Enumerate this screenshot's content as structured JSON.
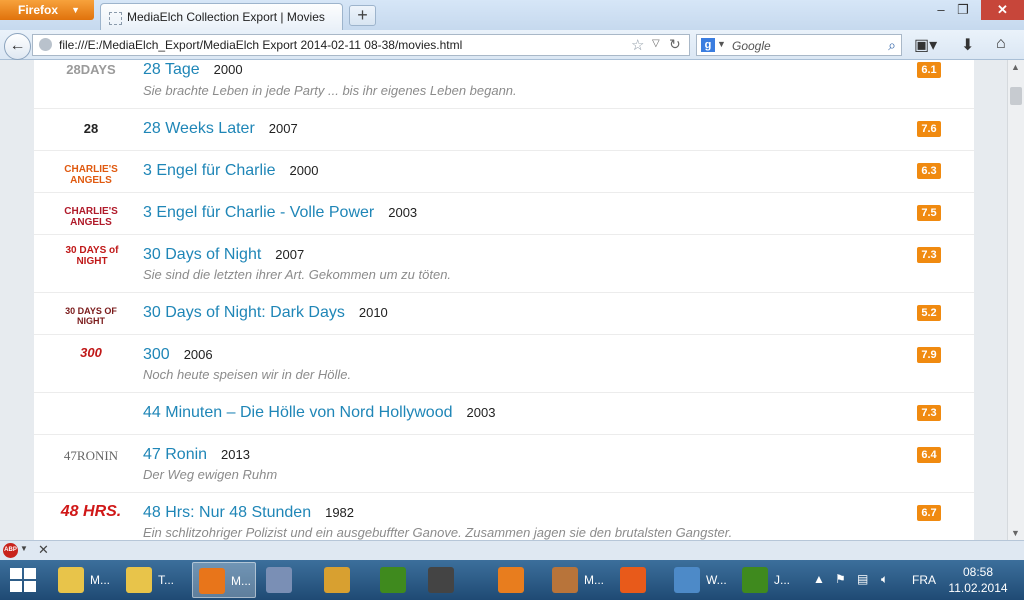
{
  "browser": {
    "menu_button": "Firefox",
    "tab_title": "MediaElch Collection Export | Movies",
    "url": "file:///E:/MediaElch_Export/MediaElch Export 2014-02-11 08-38/movies.html",
    "search_placeholder": "Google"
  },
  "movies": [
    {
      "logo_text": "28DAYS",
      "logo_color": "#9a9a9a",
      "title": "28 Tage",
      "year": "2000",
      "tagline": "Sie brachte Leben in jede Party ... bis ihr eigenes Leben begann.",
      "rating": "6.1"
    },
    {
      "logo_text": "28",
      "logo_color": "#222222",
      "title": "28 Weeks Later",
      "year": "2007",
      "tagline": "",
      "rating": "7.6"
    },
    {
      "logo_text": "CHARLIE'S ANGELS",
      "logo_color": "#e05a10",
      "title": "3 Engel für Charlie",
      "year": "2000",
      "tagline": "",
      "rating": "6.3"
    },
    {
      "logo_text": "CHARLIE'S ANGELS",
      "logo_color": "#b01a2a",
      "title": "3 Engel für Charlie - Volle Power",
      "year": "2003",
      "tagline": "",
      "rating": "7.5"
    },
    {
      "logo_text": "30 DAYS of NIGHT",
      "logo_color": "#c01818",
      "title": "30 Days of Night",
      "year": "2007",
      "tagline": "Sie sind die letzten ihrer Art. Gekommen um zu töten.",
      "rating": "7.3"
    },
    {
      "logo_text": "30 DAYS OF NIGHT",
      "logo_color": "#7a1a1a",
      "title": "30 Days of Night: Dark Days",
      "year": "2010",
      "tagline": "",
      "rating": "5.2"
    },
    {
      "logo_text": "300",
      "logo_color": "#c01818",
      "title": "300",
      "year": "2006",
      "tagline": "Noch heute speisen wir in der Hölle.",
      "rating": "7.9"
    },
    {
      "logo_text": "",
      "logo_color": "#ffffff",
      "title": "44 Minuten – Die Hölle von Nord Hollywood",
      "year": "2003",
      "tagline": "",
      "rating": "7.3"
    },
    {
      "logo_text": "47RONIN",
      "logo_color": "#666666",
      "title": "47 Ronin",
      "year": "2013",
      "tagline": "Der Weg ewigen Ruhm",
      "rating": "6.4"
    },
    {
      "logo_text": "48 HRS.",
      "logo_color": "#d01818",
      "title": "48 Hrs: Nur 48 Stunden",
      "year": "1982",
      "tagline": "Ein schlitzohriger Polizist und ein ausgebuffter Ganove. Zusammen jagen sie den brutalsten Gangster.",
      "rating": "6.7"
    }
  ],
  "taskbar": {
    "buttons": [
      {
        "label": "M...",
        "icon": "folder-icon",
        "color": "#e8c44a"
      },
      {
        "label": "T...",
        "icon": "folder-icon",
        "color": "#e8c44a"
      },
      {
        "label": "M...",
        "icon": "firefox-icon",
        "color": "#e8751a"
      },
      {
        "label": "",
        "icon": "inkscape-icon",
        "color": "#7a8fb5"
      },
      {
        "label": "",
        "icon": "cocktail-icon",
        "color": "#d8a030"
      },
      {
        "label": "",
        "icon": "app-q-icon",
        "color": "#3f8a1e"
      },
      {
        "label": "",
        "icon": "clapper-icon",
        "color": "#444444"
      },
      {
        "label": "",
        "icon": "outlook-icon",
        "color": "#e87d1e"
      },
      {
        "label": "M...",
        "icon": "mediaelch-icon",
        "color": "#b8743a"
      },
      {
        "label": "",
        "icon": "fire-icon",
        "color": "#e85a1a"
      },
      {
        "label": "W...",
        "icon": "window-icon",
        "color": "#4d8ac8"
      },
      {
        "label": "J...",
        "icon": "app-q-icon",
        "color": "#3f8a1e"
      }
    ],
    "language": "FRA",
    "time": "08:58",
    "date": "11.02.2014"
  }
}
